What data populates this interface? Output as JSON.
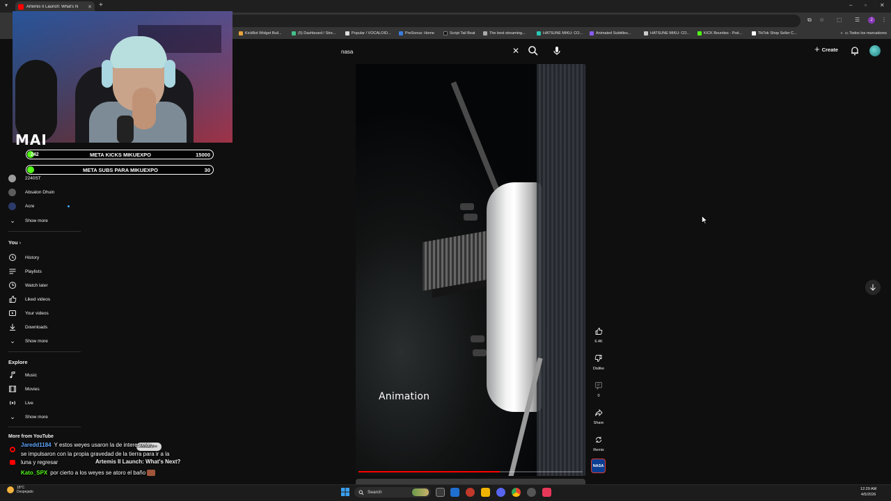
{
  "browser": {
    "active_tab_title": "Artemis II Launch: What's N",
    "bookmarks": [
      "KickBot Widget Buil...",
      "(5) Dashboard / Stre...",
      "Popular / VOCALOID...",
      "PreSonus: Home",
      "Script Tail Beat",
      "The best streaming...",
      "HATSUNE MIKU: CO...",
      "Animated Subtitles...",
      "HATSUNE MIKU: CO...",
      "KICK Bounties - Pod...",
      "TikTok Shop Seller C..."
    ],
    "all_bookmarks_label": "Todos los marcadores"
  },
  "header": {
    "search_query": "nasa",
    "create_label": "Create"
  },
  "sidebar": {
    "subscriptions_partial": [
      "2240ST",
      "Absalon Dhuin",
      "Acre"
    ],
    "subscriptions_show_more": "Show more",
    "you_section": {
      "title": "You",
      "items": [
        {
          "label": "History",
          "icon": "history-icon"
        },
        {
          "label": "Playlists",
          "icon": "playlists-icon"
        },
        {
          "label": "Watch later",
          "icon": "watch-later-icon"
        },
        {
          "label": "Liked videos",
          "icon": "like-icon"
        },
        {
          "label": "Your videos",
          "icon": "your-videos-icon"
        },
        {
          "label": "Downloads",
          "icon": "download-icon"
        }
      ],
      "show_more": "Show more"
    },
    "explore_section": {
      "title": "Explore",
      "items": [
        {
          "label": "Music",
          "icon": "music-icon"
        },
        {
          "label": "Movies",
          "icon": "movies-icon"
        },
        {
          "label": "Live",
          "icon": "live-icon"
        }
      ],
      "show_more": "Show more"
    },
    "more_from_youtube": "More from YouTube"
  },
  "stream_overlay": {
    "cam_label": "MAI",
    "goals": [
      {
        "current": "242",
        "name": "META KICKS MIKUEXPO",
        "target": "15000",
        "progress": 0.016
      },
      {
        "current": "",
        "name": "META SUBS PARA MIKUEXPO",
        "target": "30",
        "progress": 0.03
      }
    ],
    "chat": [
      {
        "user": "Jaredd1184",
        "message": "Y estos weyes usaron la de interestelar,"
      },
      {
        "user": "",
        "message": "se impulsaron con la propia gravedad de la tierra para ir a la"
      },
      {
        "user": "",
        "message": "luna y regresar"
      },
      {
        "user": "Kato_SPX",
        "message": "por cierto a los weyes se atoro el baño"
      }
    ],
    "underlay_video_title": "Artemis II Launch: What's Next?",
    "underlay_subscribe": "Subscribe"
  },
  "video": {
    "caption": "Animation",
    "progress": 0.63,
    "channel_logo": "NASA",
    "actions": [
      {
        "name": "like-button",
        "icon": "like-icon",
        "label": "6.4K"
      },
      {
        "name": "dislike-button",
        "icon": "dislike-icon",
        "label": "Dislike"
      },
      {
        "name": "comments-button",
        "icon": "comment-icon",
        "label": "0"
      },
      {
        "name": "share-button",
        "icon": "share-icon",
        "label": "Share"
      },
      {
        "name": "remix-button",
        "icon": "remix-icon",
        "label": "Remix"
      }
    ]
  },
  "taskbar": {
    "weather_temp": "18°C",
    "weather_desc": "Despejado",
    "search_label": "Search",
    "time": "12:29 AM",
    "date": "4/5/2026"
  },
  "colors": {
    "background": "#0f0f0f",
    "kick_green": "#53fc18",
    "yt_red": "#ff0000",
    "nasa_blue": "#0b3d91"
  }
}
